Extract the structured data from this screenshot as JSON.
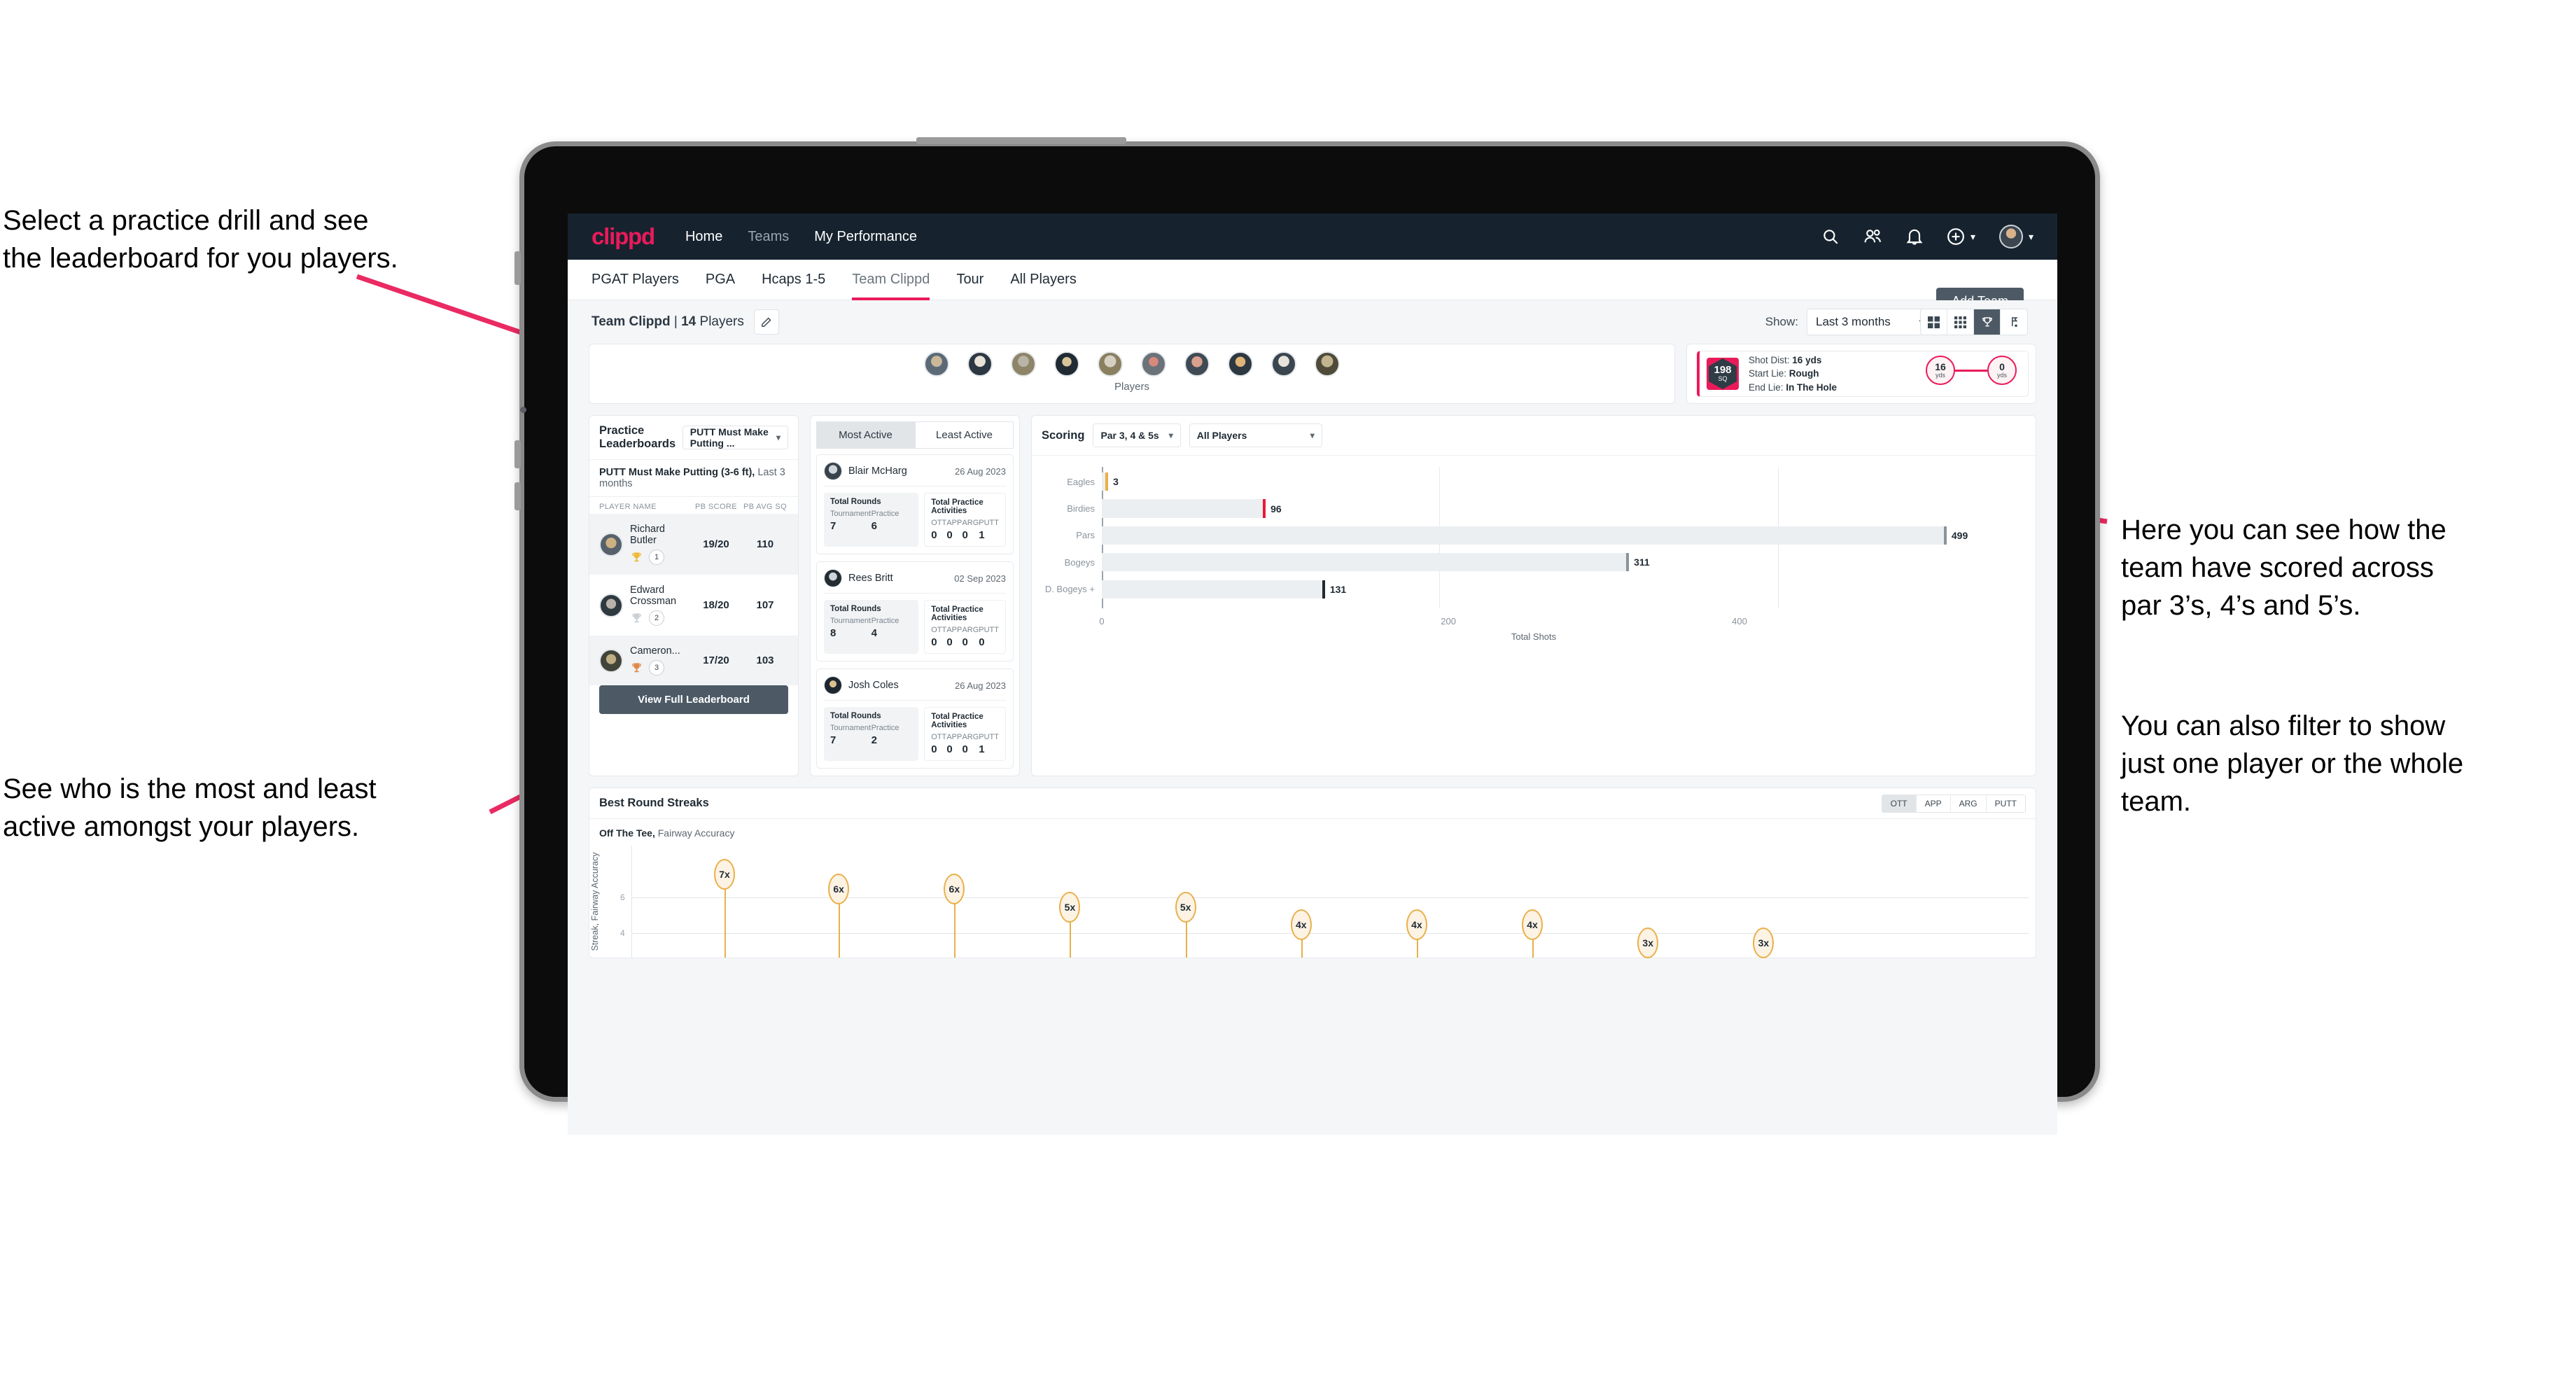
{
  "annotations": {
    "left_top": "Select a practice drill and see\nthe leaderboard for you players.",
    "left_bottom": "See who is the most and least\nactive amongst your players.",
    "right_top": "Here you can see how the\nteam have scored across\npar 3’s, 4’s and 5’s.",
    "right_bottom": "You can also filter to show\njust one player or the whole\nteam."
  },
  "colors": {
    "brand_pink": "#ea1a5a",
    "nav_dark": "#16232f",
    "button_slate": "#4d5a66",
    "gold": "#e9b04a",
    "bar_grey": "#eceff1"
  },
  "topnav": {
    "logo": "clippd",
    "links": [
      {
        "label": "Home",
        "dim": false
      },
      {
        "label": "Teams",
        "dim": true
      },
      {
        "label": "My Performance",
        "dim": false
      }
    ],
    "icons": [
      "search-icon",
      "people-icon",
      "bell-icon",
      "plus-circle-icon",
      "avatar"
    ]
  },
  "tabs": {
    "items": [
      {
        "label": "PGAT Players",
        "active": false
      },
      {
        "label": "PGA",
        "active": false
      },
      {
        "label": "Hcaps 1-5",
        "active": false
      },
      {
        "label": "Team Clippd",
        "active": true
      },
      {
        "label": "Tour",
        "active": false
      },
      {
        "label": "All Players",
        "active": false
      }
    ],
    "add_team_label": "Add Team"
  },
  "subhead": {
    "team_name": "Team Clippd",
    "separator": " | ",
    "player_count": "14",
    "players_word": " Players",
    "edit_icon": "pencil-icon",
    "show_label": "Show:",
    "show_value": "Last 3 months",
    "view_toggle": [
      {
        "icon": "grid-large-icon",
        "selected": false
      },
      {
        "icon": "grid-small-icon",
        "selected": false
      },
      {
        "icon": "trophy-icon",
        "selected": true
      },
      {
        "icon": "flag-icon",
        "selected": false
      }
    ]
  },
  "players_strip": {
    "label": "Players",
    "avatar_count": 10
  },
  "shot_card": {
    "sq_value": "198",
    "sq_unit": "SQ",
    "shot_dist_label": "Shot Dist:",
    "shot_dist_value": "16 yds",
    "start_lie_label": "Start Lie:",
    "start_lie_value": "Rough",
    "end_lie_label": "End Lie:",
    "end_lie_value": "In The Hole",
    "node_start_value": "16",
    "node_start_unit": "yds",
    "node_end_value": "0",
    "node_end_unit": "yds"
  },
  "leaderboard": {
    "title": "Practice Leaderboards",
    "drill_select": "PUTT Must Make Putting ...",
    "subtitle_bold": "PUTT Must Make Putting (3-6 ft),",
    "subtitle_rest": " Last 3 months",
    "columns": [
      "PLAYER NAME",
      "PB SCORE",
      "PB AVG SQ"
    ],
    "rows": [
      {
        "name": "Richard Butler",
        "rank": "1",
        "trophy": "gold",
        "pb_score": "19/20",
        "pb_avg_sq": "110"
      },
      {
        "name": "Edward Crossman",
        "rank": "2",
        "trophy": "silver",
        "pb_score": "18/20",
        "pb_avg_sq": "107"
      },
      {
        "name": "Cameron...",
        "rank": "3",
        "trophy": "bronze",
        "pb_score": "17/20",
        "pb_avg_sq": "103"
      }
    ],
    "view_full_label": "View Full Leaderboard"
  },
  "activity": {
    "tabs": [
      {
        "label": "Most Active",
        "selected": true
      },
      {
        "label": "Least Active",
        "selected": false
      }
    ],
    "rounds_title": "Total Rounds",
    "rounds_keys": [
      "Tournament",
      "Practice"
    ],
    "practice_title": "Total Practice Activities",
    "practice_keys": [
      "OTT",
      "APP",
      "ARG",
      "PUTT"
    ],
    "players": [
      {
        "name": "Blair McHarg",
        "date": "26 Aug 2023",
        "tournament": "7",
        "practice": "6",
        "ott": "0",
        "app": "0",
        "arg": "0",
        "putt": "1"
      },
      {
        "name": "Rees Britt",
        "date": "02 Sep 2023",
        "tournament": "8",
        "practice": "4",
        "ott": "0",
        "app": "0",
        "arg": "0",
        "putt": "0"
      },
      {
        "name": "Josh Coles",
        "date": "26 Aug 2023",
        "tournament": "7",
        "practice": "2",
        "ott": "0",
        "app": "0",
        "arg": "0",
        "putt": "1"
      }
    ]
  },
  "scoring": {
    "title": "Scoring",
    "par_select": "Par 3, 4 & 5s",
    "player_select": "All Players"
  },
  "streaks": {
    "title": "Best Round Streaks",
    "toggle": [
      {
        "label": "OTT",
        "selected": true
      },
      {
        "label": "APP",
        "selected": false
      },
      {
        "label": "ARG",
        "selected": false
      },
      {
        "label": "PUTT",
        "selected": false
      }
    ],
    "sub_bold": "Off The Tee,",
    "sub_rest": " Fairway Accuracy"
  },
  "chart_data": [
    {
      "type": "bar",
      "orientation": "horizontal",
      "title": "Scoring",
      "categories": [
        "Eagles",
        "Birdies",
        "Pars",
        "Bogeys",
        "D. Bogeys +"
      ],
      "values": [
        3,
        96,
        499,
        311,
        131
      ],
      "cap_colors": [
        "#e9b04a",
        "#ea1a3a",
        "#8a939b",
        "#8a939b",
        "#1f2a33"
      ],
      "xlabel": "Total Shots",
      "ylabel": "",
      "xlim": [
        0,
        540
      ],
      "xticks": [
        0,
        200,
        400
      ],
      "grid": true,
      "legend": "none"
    },
    {
      "type": "scatter",
      "title": "Off The Tee, Fairway Accuracy",
      "ylabel": "Streak, Fairway Accuracy",
      "xlabel": "",
      "ylim": [
        0,
        8
      ],
      "yticks": [
        4,
        6
      ],
      "grid": true,
      "labels": [
        "7x",
        "6x",
        "6x",
        "5x",
        "5x",
        "4x",
        "4x",
        "4x",
        "3x",
        "3x"
      ],
      "values": [
        7,
        6,
        6,
        5,
        5,
        4,
        4,
        4,
        3,
        3
      ],
      "legend": "none"
    }
  ]
}
